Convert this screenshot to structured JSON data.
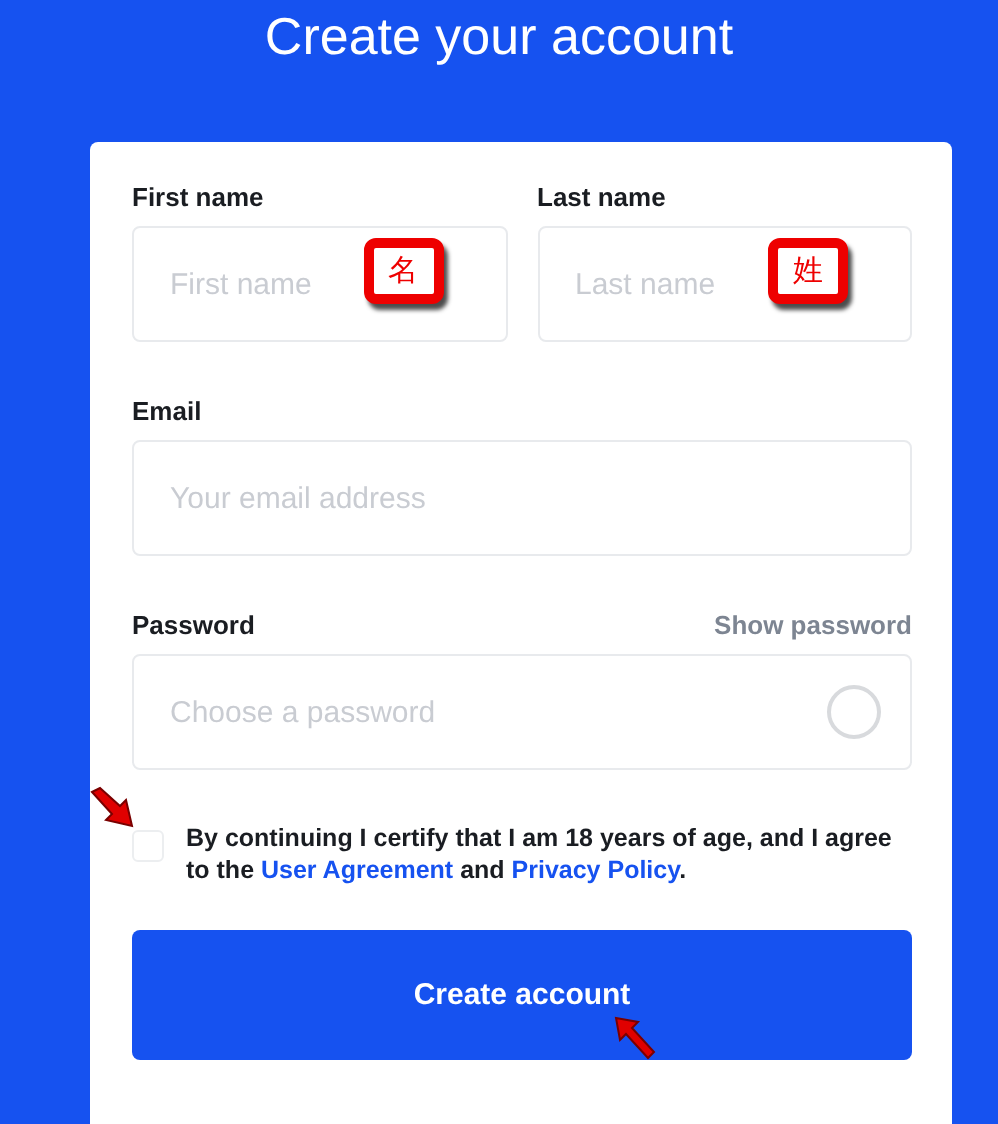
{
  "title": "Create your account",
  "name_fields": [
    {
      "label": "First name",
      "placeholder": "First name",
      "annotation": "名"
    },
    {
      "label": "Last name",
      "placeholder": "Last name",
      "annotation": "姓"
    }
  ],
  "email": {
    "label": "Email",
    "placeholder": "Your email address"
  },
  "password": {
    "label": "Password",
    "toggle": "Show password",
    "placeholder": "Choose a password"
  },
  "consent": {
    "checked": false,
    "text": "By continuing I certify that I am 18 years of age, and I agree to the ",
    "link_1": "User Agreement",
    "middle": " and ",
    "link_2": "Privacy Policy",
    "end": "."
  },
  "submit_button": "Create account"
}
